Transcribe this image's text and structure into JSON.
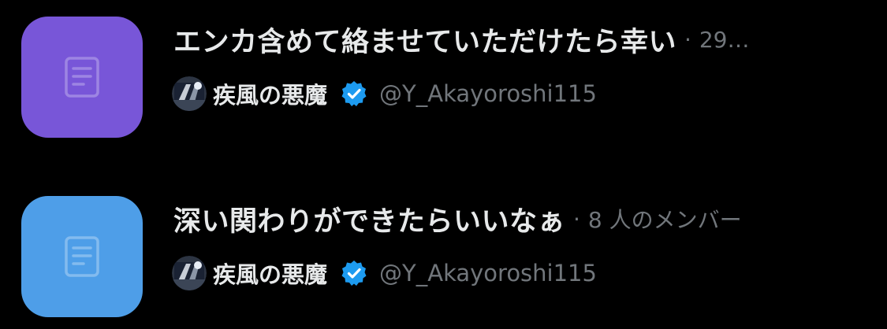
{
  "lists": [
    {
      "icon": "document-icon",
      "tile_color": "#7856d8",
      "title": "エンカ含めて絡ませていただけたら幸い",
      "separator": "·",
      "meta": "29…",
      "owner": {
        "name": "疾風の悪魔",
        "verified": true,
        "handle": "@Y_Akayoroshi115"
      }
    },
    {
      "icon": "document-icon",
      "tile_color": "#4e9ee8",
      "title": "深い関わりができたらいいなぁ",
      "separator": "·",
      "meta": "8 人のメンバー",
      "owner": {
        "name": "疾風の悪魔",
        "verified": true,
        "handle": "@Y_Akayoroshi115"
      }
    }
  ],
  "colors": {
    "background": "#000000",
    "primary_text": "#e7e9ea",
    "secondary_text": "#71767b",
    "verified_badge": "#1d9bf0"
  }
}
